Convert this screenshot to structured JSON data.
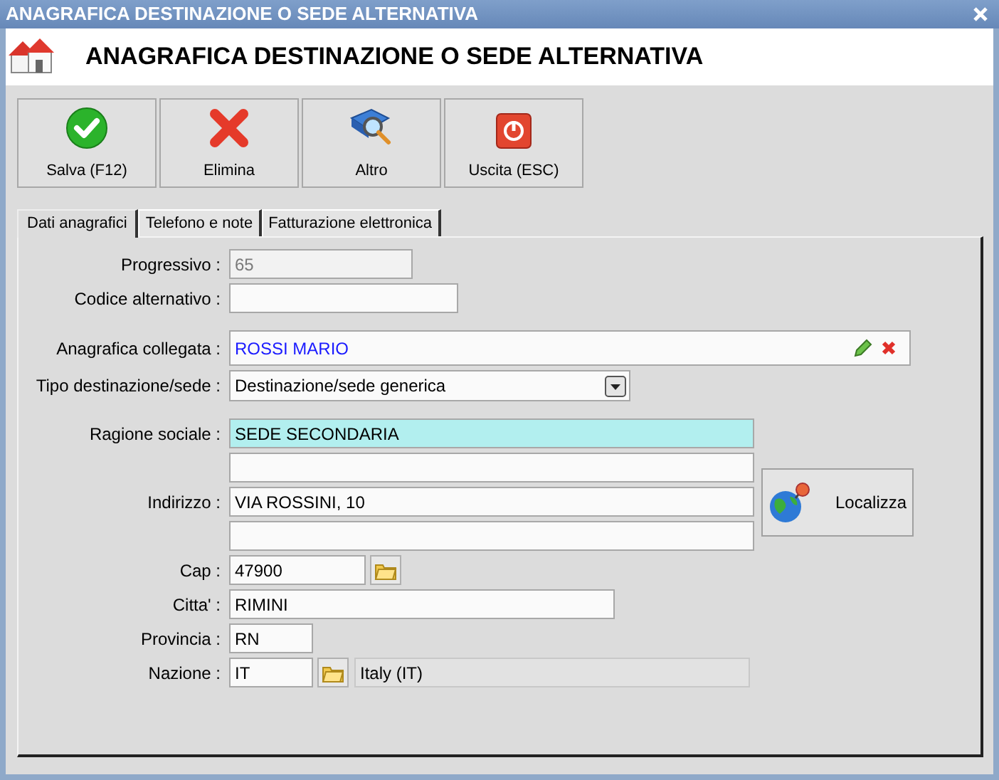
{
  "window": {
    "title": "ANAGRAFICA DESTINAZIONE O SEDE ALTERNATIVA"
  },
  "header": {
    "title": "ANAGRAFICA DESTINAZIONE O SEDE ALTERNATIVA"
  },
  "toolbar": [
    {
      "kind": "save",
      "label": "Salva (F12)"
    },
    {
      "kind": "delete",
      "label": "Elimina"
    },
    {
      "kind": "search",
      "label": "Altro"
    },
    {
      "kind": "exit",
      "label": "Uscita (ESC)"
    }
  ],
  "tabs": [
    {
      "label": "Dati anagrafici",
      "selected": true
    },
    {
      "label": "Telefono e note",
      "selected": false
    },
    {
      "label": "Fatturazione elettronica",
      "selected": false
    }
  ],
  "form": {
    "sections": [
      [
        {
          "kind": "text",
          "label": "Progressivo :",
          "value": "65",
          "disabled": true,
          "highlighted": false
        },
        {
          "kind": "text",
          "label": "Codice alternativo :",
          "highlighted": false
        }
      ],
      [
        {
          "kind": "linked",
          "label": "Anagrafica collegata :",
          "value": "ROSSI MARIO"
        },
        {
          "kind": "select",
          "label": "Tipo destinazione/sede :",
          "value": "Destinazione/sede generica"
        }
      ],
      [
        {
          "kind": "text",
          "label": "Ragione sociale :",
          "value": "SEDE SECONDARIA",
          "highlighted": true
        },
        {
          "kind": "address",
          "label": "Indirizzo :",
          "lines": [
            {
              "kind": "blank"
            },
            {
              "kind": "filled",
              "value": "VIA ROSSINI, 10"
            },
            {
              "kind": "blank"
            }
          ],
          "button": "Localizza"
        },
        {
          "kind": "lookup",
          "label": "Cap :",
          "value": "47900"
        },
        {
          "kind": "text",
          "label": "Citta' :",
          "value": "RIMINI",
          "highlighted": false
        },
        {
          "kind": "text",
          "label": "Provincia :",
          "value": "RN",
          "highlighted": false
        },
        {
          "kind": "lookup",
          "label": "Nazione :",
          "value": "IT",
          "description": "Italy (IT)"
        }
      ]
    ]
  }
}
